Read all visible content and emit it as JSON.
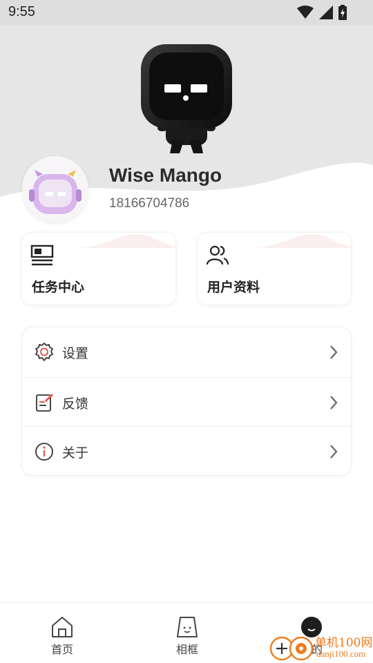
{
  "status_bar": {
    "time": "9:55"
  },
  "profile": {
    "name": "Wise Mango",
    "phone": "18166704786"
  },
  "quick_cards": [
    {
      "label": "任务中心",
      "icon": "task-board-icon"
    },
    {
      "label": "用户资料",
      "icon": "users-icon"
    }
  ],
  "menu": [
    {
      "label": "设置",
      "icon": "gear-icon"
    },
    {
      "label": "反馈",
      "icon": "feedback-icon"
    },
    {
      "label": "关于",
      "icon": "info-icon"
    }
  ],
  "bottom_nav": [
    {
      "label": "首页",
      "icon": "home-icon"
    },
    {
      "label": "相框",
      "icon": "frame-icon"
    },
    {
      "label": "我的",
      "icon": "mine-icon",
      "active": true
    }
  ],
  "watermark": {
    "text": "单机100网",
    "url": "danji100.com"
  },
  "colors": {
    "accent": "#e8554e",
    "header_bg": "#e6e6e6",
    "watermark": "#f07a1a"
  }
}
